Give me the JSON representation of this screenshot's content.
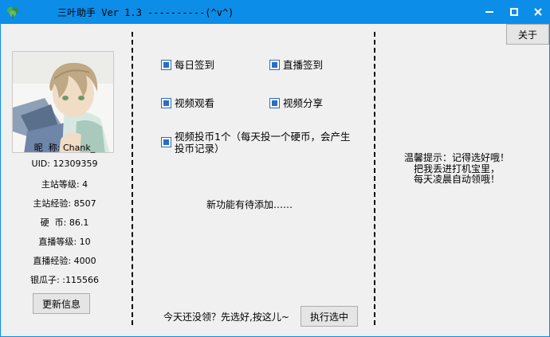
{
  "window": {
    "title": "三叶助手 Ver 1.3 ----------(^v^)",
    "controls": {
      "minimize": "minimize-icon",
      "maximize": "maximize-icon",
      "close": "close-icon"
    }
  },
  "about_button": "关于",
  "profile": {
    "nickname": "昵  称: Chank_",
    "uid": "UID: 12309359",
    "main_level": "主站等级: 4",
    "main_exp": "主站经验: 8507",
    "coins": "硬  币: 86.1",
    "live_level": "直播等级: 10",
    "live_exp": "直播经验: 4000",
    "silver": "银瓜子: :115566"
  },
  "update_button": "更新信息",
  "tasks": [
    {
      "label": "每日签到",
      "checked": true
    },
    {
      "label": "直播签到",
      "checked": true
    },
    {
      "label": "视频观看",
      "checked": true
    },
    {
      "label": "视频分享",
      "checked": true
    },
    {
      "label": "视频投币1个（每天投一个硬币，会产生投币记录）",
      "checked": true
    }
  ],
  "notice": "新功能有待添加……",
  "footer_prompt": "今天还没领？先选好,按这儿~",
  "execute_button": "执行选中",
  "tip": {
    "line1": "温馨提示：记得选好哦！",
    "line2": "把我丢进打机宝里，",
    "line3": "每天凌晨自动领哦！"
  },
  "colors": {
    "titlebar": "#0c8de8",
    "background": "#f0f0f0",
    "checkbox_fill": "#2b6cc4"
  }
}
